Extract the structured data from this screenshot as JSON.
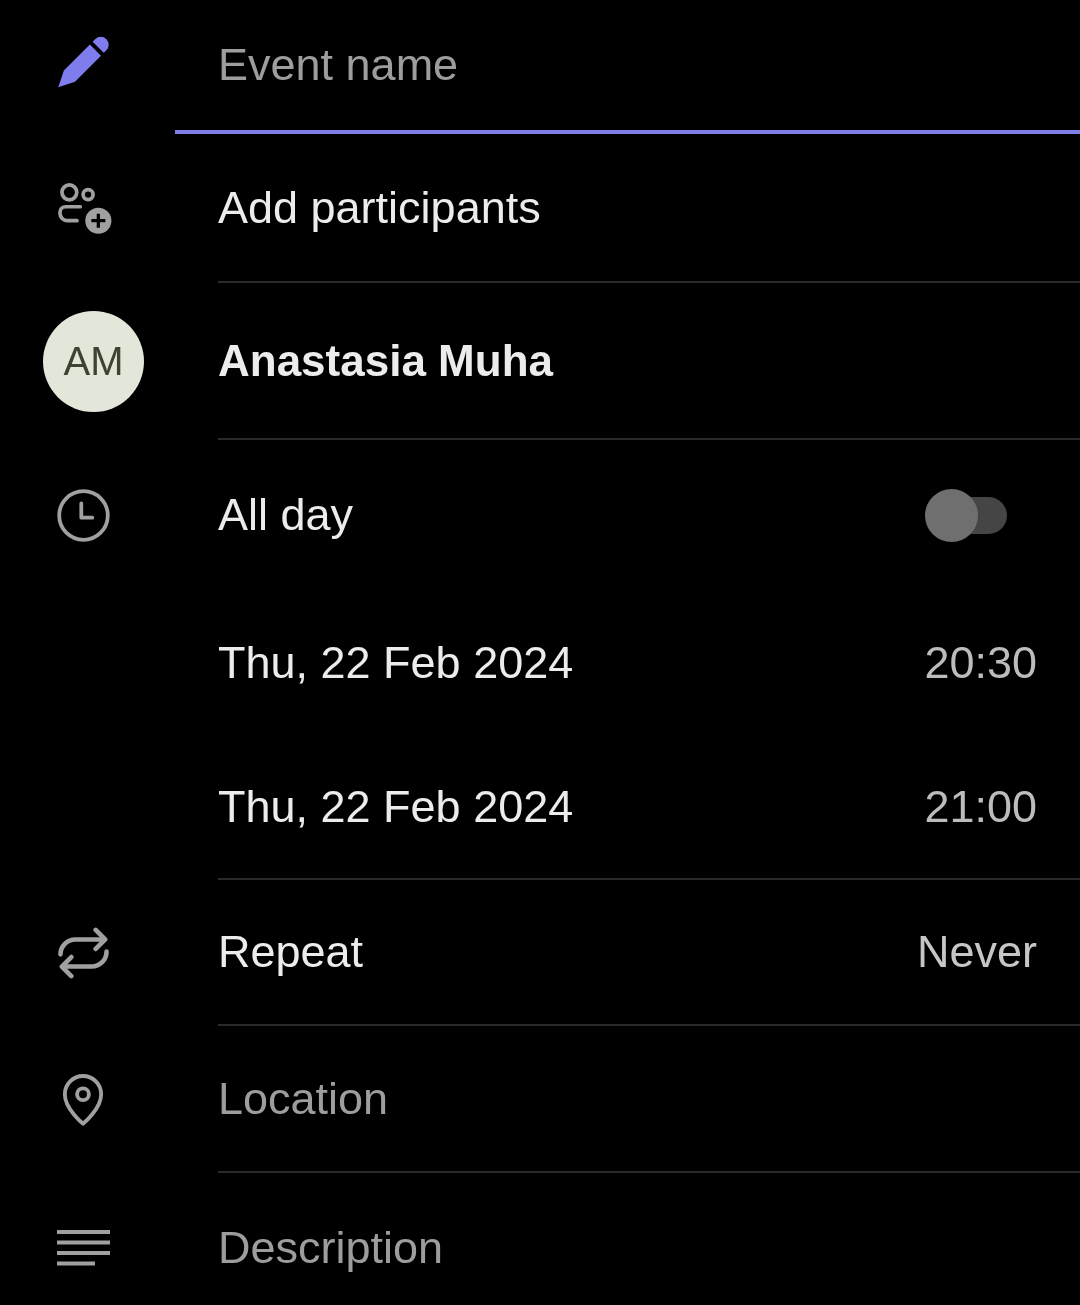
{
  "event_name": {
    "placeholder": "Event name",
    "focused": true
  },
  "participants": {
    "label": "Add participants"
  },
  "organizer": {
    "initials": "AM",
    "name": "Anastasia Muha"
  },
  "all_day": {
    "label": "All day",
    "on": false
  },
  "start": {
    "date": "Thu, 22 Feb 2024",
    "time": "20:30"
  },
  "end": {
    "date": "Thu, 22 Feb 2024",
    "time": "21:00"
  },
  "repeat": {
    "label": "Repeat",
    "value": "Never"
  },
  "location": {
    "placeholder": "Location"
  },
  "description": {
    "placeholder": "Description"
  }
}
